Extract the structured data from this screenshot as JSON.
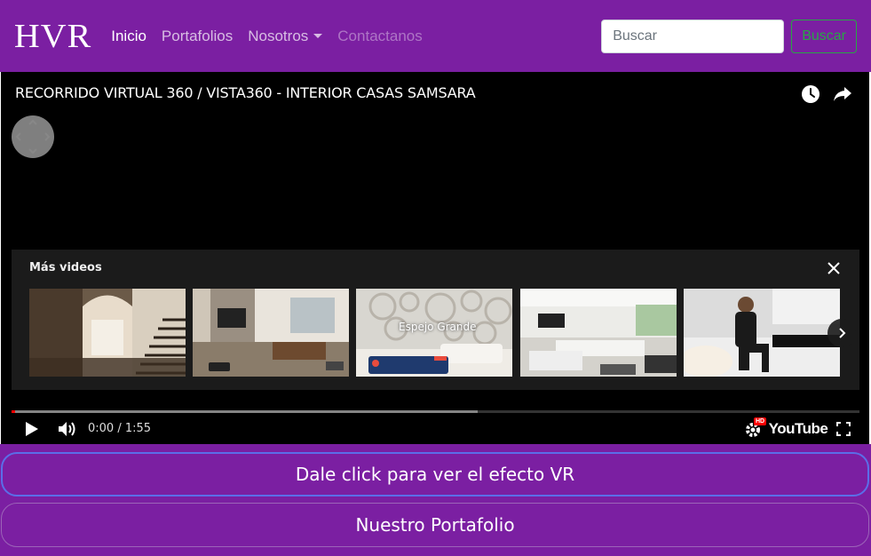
{
  "navbar": {
    "brand": "HVR",
    "links": {
      "inicio": "Inicio",
      "portafolios": "Portafolios",
      "nosotros": "Nosotros",
      "contactanos": "Contactanos"
    },
    "search_placeholder": "Buscar",
    "search_button": "Buscar"
  },
  "video": {
    "title": "RECORRIDO VIRTUAL 360 / VISTA360 - INTERIOR CASAS SAMSARA",
    "more_videos_title": "Más videos",
    "thumbnail_text": "Espejo Grande",
    "time": "0:00 / 1:55",
    "progress_loaded_fraction": 0.55,
    "progress_played_fraction": 0.004,
    "youtube_label": "YouTube",
    "hd_badge": "HD"
  },
  "buttons": {
    "vr": "Dale click para ver el efecto VR",
    "portfolio": "Nuestro Portafolio"
  },
  "colors": {
    "brand_purple": "#7b1fa2",
    "search_green": "#28a745",
    "youtube_red": "#ff0000"
  }
}
